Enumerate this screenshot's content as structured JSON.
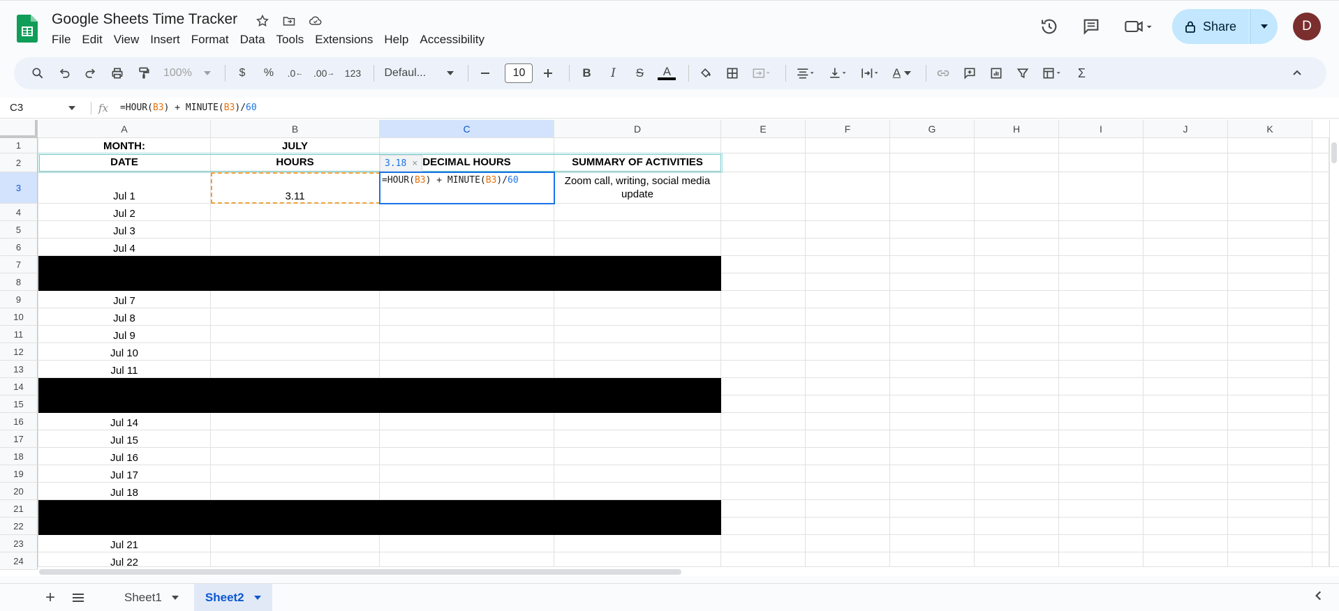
{
  "app": {
    "title": "Google Sheets Time Tracker",
    "avatar_letter": "D",
    "share_label": "Share"
  },
  "menu": [
    "File",
    "Edit",
    "View",
    "Insert",
    "Format",
    "Data",
    "Tools",
    "Extensions",
    "Help",
    "Accessibility"
  ],
  "toolbar": {
    "zoom": "100%",
    "currency": "$",
    "percent": "%",
    "dec_decrease": ".0",
    "dec_increase": ".00",
    "number_format": "123",
    "font": "Defaul...",
    "font_size": "10",
    "bold": "B",
    "italic": "I",
    "strike": "S",
    "text_color": "A",
    "text_rotate": "A",
    "sum": "Σ"
  },
  "formula_bar": {
    "name_box": "C3",
    "fx": "fx",
    "f1": "=HOUR(",
    "f2": "B3",
    "f3": ") + MINUTE(",
    "f4": "B3",
    "f5": ")/",
    "f6": "60"
  },
  "columns": [
    "A",
    "B",
    "C",
    "D",
    "E",
    "F",
    "G",
    "H",
    "I",
    "J",
    "K"
  ],
  "rows": [
    "1",
    "2",
    "3",
    "4",
    "5",
    "6",
    "7",
    "8",
    "9",
    "10",
    "11",
    "12",
    "13",
    "14",
    "15",
    "16",
    "17",
    "18",
    "19",
    "20",
    "21",
    "22",
    "23",
    "24"
  ],
  "cells": {
    "a1": "MONTH:",
    "b1": "JULY",
    "a2": "DATE",
    "b2": "HOURS",
    "c2": "DECIMAL HOURS",
    "d2": "SUMMARY OF ACTIVITIES",
    "a3": "Jul 1",
    "b3": "3.11",
    "d3": "Zoom call, writing, social media update",
    "a4": "Jul 2",
    "a5": "Jul 3",
    "a6": "Jul 4",
    "a9": "Jul 7",
    "a10": "Jul 8",
    "a11": "Jul 9",
    "a12": "Jul 10",
    "a13": "Jul 11",
    "a16": "Jul 14",
    "a17": "Jul 15",
    "a18": "Jul 16",
    "a19": "Jul 17",
    "a20": "Jul 18",
    "a23": "Jul 21",
    "a24": "Jul 22"
  },
  "preview": {
    "value": "3.18",
    "close": "×"
  },
  "sheets": {
    "add": "+",
    "tab1": "Sheet1",
    "tab2": "Sheet2"
  },
  "colors": {
    "accent": "#1a73e8",
    "share_bg": "#c2e7ff",
    "selected_header": "#d3e3fd",
    "copy_border": "#e8a23a"
  }
}
